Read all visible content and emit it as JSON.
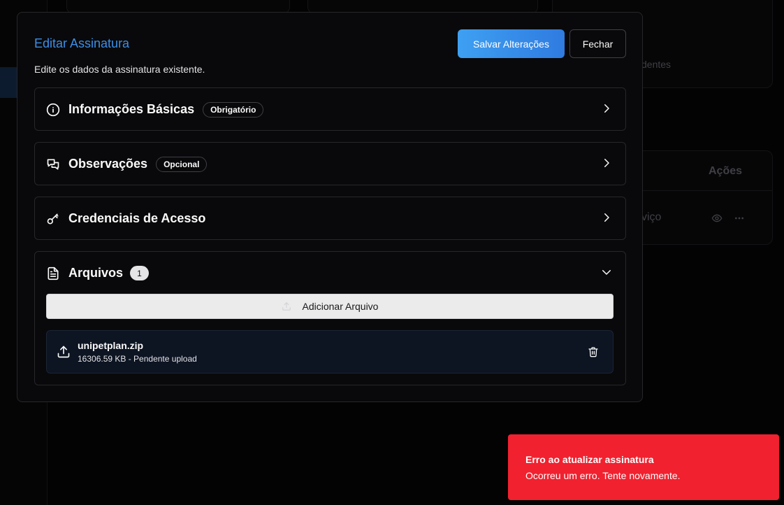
{
  "background": {
    "card_fragment_text": "dentes",
    "table_header_actions": "Ações",
    "table_cell_fragment": "viço",
    "view_icon": "eye-icon",
    "more_icon": "more-horizontal-icon"
  },
  "modal": {
    "title": "Editar Assinatura",
    "subtitle": "Edite os dados da assinatura existente.",
    "save_label": "Salvar Alterações",
    "close_label": "Fechar",
    "sections": [
      {
        "title": "Informações Básicas",
        "badge": "Obrigatório",
        "icon": "info-icon",
        "expanded": false
      },
      {
        "title": "Observações",
        "badge": "Opcional",
        "icon": "messages-icon",
        "expanded": false
      },
      {
        "title": "Credenciais de Acesso",
        "badge": "",
        "icon": "key-icon",
        "expanded": false
      },
      {
        "title": "Arquivos",
        "count": "1",
        "icon": "file-text-icon",
        "expanded": true
      }
    ],
    "files": {
      "add_label": "Adicionar Arquivo",
      "items": [
        {
          "name": "unipetplan.zip",
          "meta": "16306.59 KB - Pendente upload"
        }
      ]
    }
  },
  "toast": {
    "title": "Erro ao atualizar assinatura",
    "message": "Ocorreu um erro. Tente novamente.",
    "color": "#f1212f"
  },
  "colors": {
    "accent": "#3b8fe8",
    "background": "#030303",
    "panel": "#09090b",
    "border": "#27272a"
  }
}
